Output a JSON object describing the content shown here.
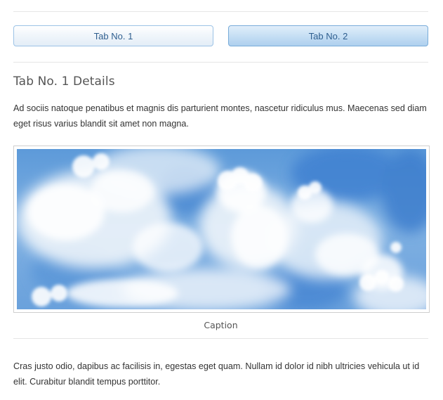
{
  "tabs": [
    {
      "label": "Tab No. 1",
      "selected": true
    },
    {
      "label": "Tab No. 2",
      "selected": false
    }
  ],
  "details": {
    "title": "Tab No. 1 Details",
    "intro": "Ad sociis natoque penatibus et magnis dis parturient montes, nascetur ridiculus mus. Maecenas sed diam eget risus varius blandit sit amet non magna.",
    "image_subject": "sky with clouds",
    "caption": "Caption",
    "body": "Cras justo odio, dapibus ac facilisis in, egestas eget quam. Nullam id dolor id nibh ultricies vehicula ut id elit. Curabitur blandit tempus porttitor."
  },
  "colors": {
    "tab_border": "#7fb2de",
    "tab_text": "#2f5f8f",
    "sky_blue": "#4f8fd6",
    "text": "#333333",
    "heading": "#555555",
    "divider": "#e6e6e6"
  }
}
